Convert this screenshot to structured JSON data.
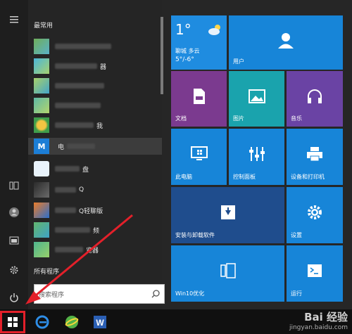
{
  "applist": {
    "section_recent": "最常用",
    "section_all": "所有程序",
    "items": [
      {
        "label": "",
        "active": false
      },
      {
        "label": "器",
        "active": false
      },
      {
        "label": "",
        "active": false
      },
      {
        "label": "",
        "active": false
      },
      {
        "label": "",
        "active": false
      },
      {
        "label": "我",
        "active": false
      },
      {
        "label": "电",
        "active": true
      },
      {
        "label": "盘",
        "active": false
      },
      {
        "label": "Q",
        "active": false
      },
      {
        "label": "Q轻聊版",
        "active": false
      },
      {
        "label": "频",
        "active": false
      },
      {
        "label": "览器",
        "active": false
      }
    ]
  },
  "search": {
    "placeholder": "搜索程序"
  },
  "weather": {
    "temp": "1°",
    "city": "聊城",
    "condition": "多云",
    "range": "5°/-6°"
  },
  "tiles": {
    "users": "用户",
    "documents": "文档",
    "pictures": "图片",
    "music": "音乐",
    "this_pc": "此电脑",
    "control_panel": "控制面板",
    "devices_printers": "设备和打印机",
    "install_uninstall": "安装与卸载软件",
    "settings": "设置",
    "win10_optimize": "Win10优化",
    "run": "运行"
  },
  "watermark": {
    "brand": "Bai 经验",
    "url": "jingyan.baidu.com"
  },
  "colors": {
    "tile_blue": "#1183d6",
    "tile_purple": "#7b3a8f",
    "tile_teal": "#119aa4",
    "tile_violet": "#6b44a5",
    "tile_navy": "#1f4d8d",
    "arrow_red": "#e3202a"
  }
}
